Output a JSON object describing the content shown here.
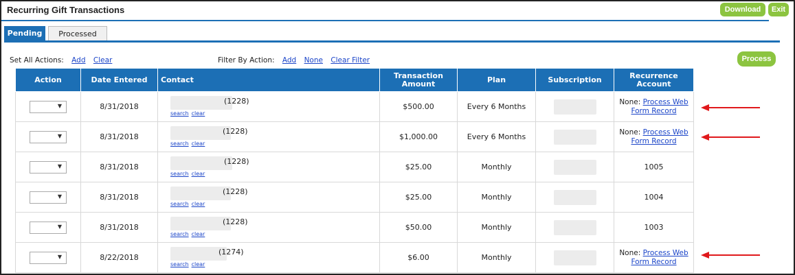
{
  "window": {
    "title": "Recurring Gift Transactions"
  },
  "toolbar": {
    "download_label": "Download",
    "exit_label": "Exit",
    "process_label": "Process"
  },
  "tabs": [
    {
      "label": "Pending",
      "active": true
    },
    {
      "label": "Processed",
      "active": false
    }
  ],
  "set_all_actions": {
    "label": "Set All Actions:",
    "add": "Add",
    "clear": "Clear"
  },
  "filter_by_action": {
    "label": "Filter By Action:",
    "add": "Add",
    "none": "None",
    "clear_filter": "Clear Filter"
  },
  "table": {
    "headers": {
      "action": "Action",
      "date_entered": "Date Entered",
      "contact": "Contact",
      "transaction_amount": "Transaction Amount",
      "plan": "Plan",
      "subscription": "Subscription",
      "recurrence_account": "Recurrence Account"
    },
    "contact_links": {
      "search": "search",
      "clear": "clear"
    },
    "recurrence_none_prefix": "None:",
    "recurrence_link": "Process Web Form Record",
    "rows": [
      {
        "date": "8/31/2018",
        "contact_id": "(1228)",
        "amount": "$500.00",
        "plan": "Every 6 Months",
        "recurrence": "None",
        "flagged": true
      },
      {
        "date": "8/31/2018",
        "contact_id": "(1228)",
        "amount": "$1,000.00",
        "plan": "Every 6 Months",
        "recurrence": "None",
        "flagged": true
      },
      {
        "date": "8/31/2018",
        "contact_id": "(1228)",
        "amount": "$25.00",
        "plan": "Monthly",
        "recurrence": "1005",
        "flagged": false
      },
      {
        "date": "8/31/2018",
        "contact_id": "(1228)",
        "amount": "$25.00",
        "plan": "Monthly",
        "recurrence": "1004",
        "flagged": false
      },
      {
        "date": "8/31/2018",
        "contact_id": "(1228)",
        "amount": "$50.00",
        "plan": "Monthly",
        "recurrence": "1003",
        "flagged": false
      },
      {
        "date": "8/22/2018",
        "contact_id": "(1274)",
        "amount": "$6.00",
        "plan": "Monthly",
        "recurrence": "None",
        "flagged": true
      }
    ]
  },
  "colors": {
    "header_blue": "#1c6fb5",
    "button_green": "#8cc440",
    "link_blue": "#1a44c8",
    "arrow_red": "#e0181b"
  },
  "icons": {
    "select_chevron": "chevron-down-icon",
    "annotation_arrow": "arrow-left-icon"
  }
}
